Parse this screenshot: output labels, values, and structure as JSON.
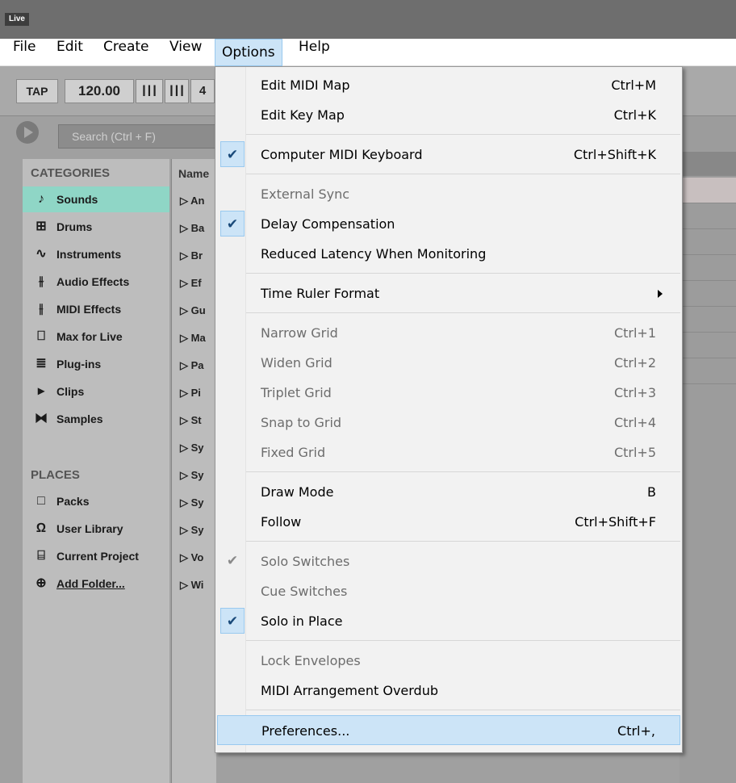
{
  "window": {
    "app_logo": "Live"
  },
  "menubar": [
    {
      "label": "File",
      "open": false
    },
    {
      "label": "Edit",
      "open": false
    },
    {
      "label": "Create",
      "open": false
    },
    {
      "label": "View",
      "open": false
    },
    {
      "label": "Options",
      "open": true
    },
    {
      "label": "Help",
      "open": false
    }
  ],
  "transport": {
    "tap": "TAP",
    "tempo": "120.00",
    "signature_num": "4"
  },
  "browser": {
    "search_placeholder": "Search (Ctrl + F)",
    "categories_header": "CATEGORIES",
    "categories": [
      {
        "label": "Sounds",
        "icon": "music-note-icon",
        "selected": true
      },
      {
        "label": "Drums",
        "icon": "drum-grid-icon",
        "selected": false
      },
      {
        "label": "Instruments",
        "icon": "waveform-icon",
        "selected": false
      },
      {
        "label": "Audio Effects",
        "icon": "audio-effect-icon",
        "selected": false
      },
      {
        "label": "MIDI Effects",
        "icon": "midi-effect-icon",
        "selected": false
      },
      {
        "label": "Max for Live",
        "icon": "max-for-live-icon",
        "selected": false
      },
      {
        "label": "Plug-ins",
        "icon": "plug-in-icon",
        "selected": false
      },
      {
        "label": "Clips",
        "icon": "clip-icon",
        "selected": false
      },
      {
        "label": "Samples",
        "icon": "sample-icon",
        "selected": false
      }
    ],
    "places_header": "PLACES",
    "places": [
      {
        "label": "Packs",
        "icon": "pack-icon"
      },
      {
        "label": "User Library",
        "icon": "user-library-icon"
      },
      {
        "label": "Current Project",
        "icon": "current-project-icon"
      },
      {
        "label": "Add Folder...",
        "icon": "add-folder-icon"
      }
    ],
    "name_header": "Name",
    "names": [
      "▷ An",
      "▷ Ba",
      "▷ Br",
      "▷ Ef",
      "▷ Gu",
      "▷ Ma",
      "▷ Pa",
      "▷ Pi",
      "▷ St",
      "▷ Sy",
      "▷ Sy",
      "▷ Sy",
      "▷ Sy",
      "▷ Vo",
      "▷ Wi"
    ]
  },
  "options_menu": {
    "groups": [
      [
        {
          "label": "Edit MIDI Map",
          "shortcut": "Ctrl+M",
          "checked": false,
          "disabled": false
        },
        {
          "label": "Edit Key Map",
          "shortcut": "Ctrl+K",
          "checked": false,
          "disabled": false
        }
      ],
      [
        {
          "label": "Computer MIDI Keyboard",
          "shortcut": "Ctrl+Shift+K",
          "checked": true,
          "disabled": false
        }
      ],
      [
        {
          "label": "External Sync",
          "shortcut": "",
          "checked": false,
          "disabled": true
        },
        {
          "label": "Delay Compensation",
          "shortcut": "",
          "checked": true,
          "disabled": false
        },
        {
          "label": "Reduced Latency When Monitoring",
          "shortcut": "",
          "checked": false,
          "disabled": false
        }
      ],
      [
        {
          "label": "Time Ruler Format",
          "shortcut": "",
          "checked": false,
          "disabled": false,
          "submenu": true
        }
      ],
      [
        {
          "label": "Narrow Grid",
          "shortcut": "Ctrl+1",
          "checked": false,
          "disabled": true
        },
        {
          "label": "Widen Grid",
          "shortcut": "Ctrl+2",
          "checked": false,
          "disabled": true
        },
        {
          "label": "Triplet Grid",
          "shortcut": "Ctrl+3",
          "checked": false,
          "disabled": true
        },
        {
          "label": "Snap to Grid",
          "shortcut": "Ctrl+4",
          "checked": false,
          "disabled": true
        },
        {
          "label": "Fixed Grid",
          "shortcut": "Ctrl+5",
          "checked": false,
          "disabled": true
        }
      ],
      [
        {
          "label": "Draw Mode",
          "shortcut": "B",
          "checked": false,
          "disabled": false
        },
        {
          "label": "Follow",
          "shortcut": "Ctrl+Shift+F",
          "checked": false,
          "disabled": false
        }
      ],
      [
        {
          "label": "Solo Switches",
          "shortcut": "",
          "checked": true,
          "disabled": true
        },
        {
          "label": "Cue Switches",
          "shortcut": "",
          "checked": false,
          "disabled": true
        },
        {
          "label": "Solo in Place",
          "shortcut": "",
          "checked": true,
          "disabled": false
        }
      ],
      [
        {
          "label": "Lock Envelopes",
          "shortcut": "",
          "checked": false,
          "disabled": true
        },
        {
          "label": "MIDI Arrangement Overdub",
          "shortcut": "",
          "checked": false,
          "disabled": false
        }
      ],
      [
        {
          "label": "Preferences...",
          "shortcut": "Ctrl+,",
          "checked": false,
          "disabled": false,
          "highlight": true
        }
      ]
    ]
  },
  "colors": {
    "accent_selected": "#8fd6c6",
    "menu_highlight": "#cce4f7",
    "disabled_text": "#6d6d6d"
  }
}
